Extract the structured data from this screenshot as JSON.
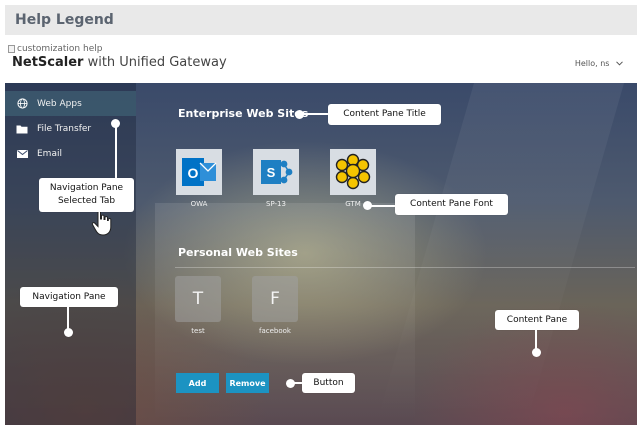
{
  "legend": {
    "title": "Help Legend"
  },
  "header": {
    "broken_image_alt": "customization help",
    "brand_bold": "NetScaler",
    "brand_rest": " with Unified Gateway",
    "user_greeting": "Hello, ns",
    "user_menu_icon": "chevron-down-icon"
  },
  "nav": {
    "items": [
      {
        "label": "Web Apps",
        "icon": "globe-icon",
        "selected": true
      },
      {
        "label": "File Transfer",
        "icon": "folder-icon",
        "selected": false
      },
      {
        "label": "Email",
        "icon": "envelope-icon",
        "selected": false
      }
    ]
  },
  "enterprise": {
    "title": "Enterprise Web Sites",
    "apps": [
      {
        "label": "OWA",
        "icon": "outlook-icon",
        "letter": "O"
      },
      {
        "label": "SP-13",
        "icon": "sharepoint-icon",
        "letter": "S"
      },
      {
        "label": "GTM",
        "icon": "flower-icon"
      }
    ]
  },
  "personal": {
    "title": "Personal Web Sites",
    "apps": [
      {
        "label": "test",
        "letter": "T"
      },
      {
        "label": "facebook",
        "letter": "F"
      }
    ]
  },
  "buttons": {
    "add": "Add",
    "remove": "Remove"
  },
  "callouts": {
    "content_pane_title": "Content Pane Title",
    "nav_selected_tab_line1": "Navigation Pane",
    "nav_selected_tab_line2": "Selected Tab",
    "content_pane_font": "Content Pane Font",
    "navigation_pane": "Navigation Pane",
    "content_pane": "Content Pane",
    "button": "Button"
  },
  "colors": {
    "accent_button": "#1c93c2",
    "outlook_blue": "#0072c6",
    "sharepoint_blue": "#1e7fc3",
    "gtm_yellow": "#f5c400"
  }
}
